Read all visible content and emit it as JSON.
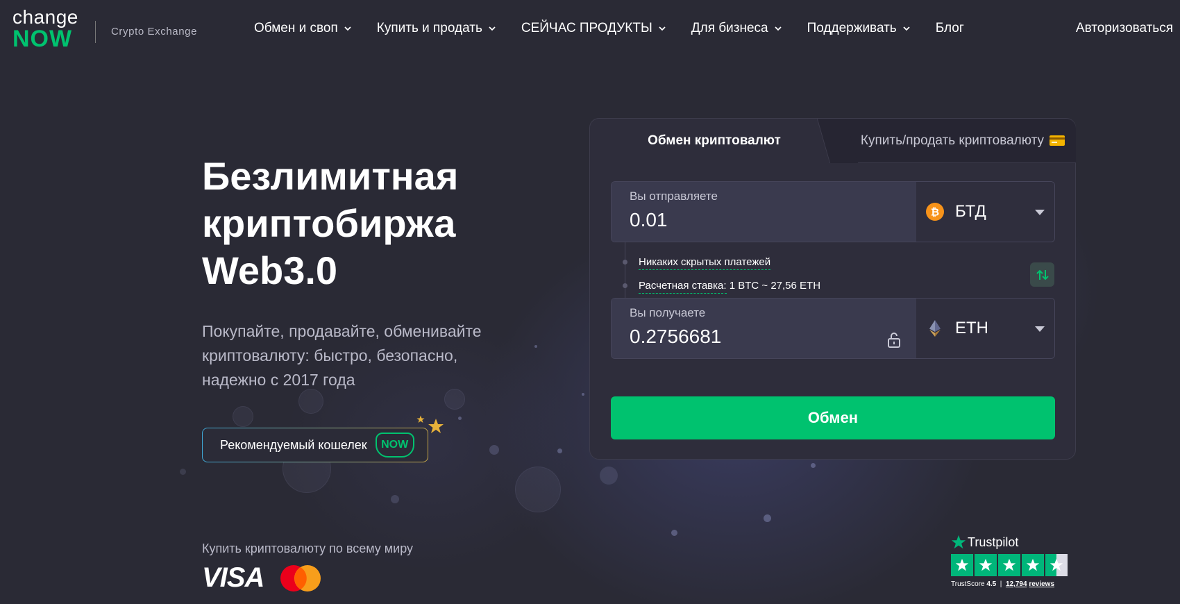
{
  "header": {
    "logo_top": "change",
    "logo_bottom": "NOW",
    "logo_subtitle": "Crypto Exchange",
    "nav": [
      {
        "label": "Обмен и своп",
        "has_dropdown": true
      },
      {
        "label": "Купить и продать",
        "has_dropdown": true
      },
      {
        "label": "СЕЙЧАС ПРОДУКТЫ",
        "has_dropdown": true
      },
      {
        "label": "Для бизнеса",
        "has_dropdown": true
      },
      {
        "label": "Поддерживать",
        "has_dropdown": true
      },
      {
        "label": "Блог",
        "has_dropdown": false
      }
    ],
    "login_label": "Авторизоваться"
  },
  "hero": {
    "title_line1": "Безлимитная",
    "title_line2": "криптобиржа",
    "title_line3": "Web3.0",
    "subtitle_line1": "Покупайте, продавайте, обменивайте",
    "subtitle_line2": "криптовалюту: быстро, безопасно,",
    "subtitle_line3": "надежно с 2017 года",
    "wallet_button_label": "Рекомендуемый кошелек",
    "wallet_badge": "NOW",
    "buy_worldwide": "Купить криптовалюту по всему миру",
    "visa_label": "VISA"
  },
  "widget": {
    "tab_exchange": "Обмен криптовалют",
    "tab_buy_sell": "Купить/продать криптовалюту",
    "send": {
      "label": "Вы отправляете",
      "value": "0.01",
      "currency": "БТД"
    },
    "info_no_fees": "Никаких скрытых платежей",
    "info_rate_label": "Расчетная ставка:",
    "info_rate_value": "1 BTC ~ 27,56 ETH",
    "receive": {
      "label": "Вы получаете",
      "value": "0.2756681",
      "currency": "ETH"
    },
    "exchange_button": "Обмен"
  },
  "trustpilot": {
    "brand": "Trustpilot",
    "rating_stars": 4.5,
    "score_label": "TrustScore",
    "score_value": "4.5",
    "reviews": "12,794",
    "reviews_label": "reviews"
  },
  "colors": {
    "accent": "#00c26f",
    "background": "#2a2a35",
    "widget_bg": "#2e2d3b",
    "bitcoin": "#f7931a",
    "trustpilot": "#00b67a"
  }
}
